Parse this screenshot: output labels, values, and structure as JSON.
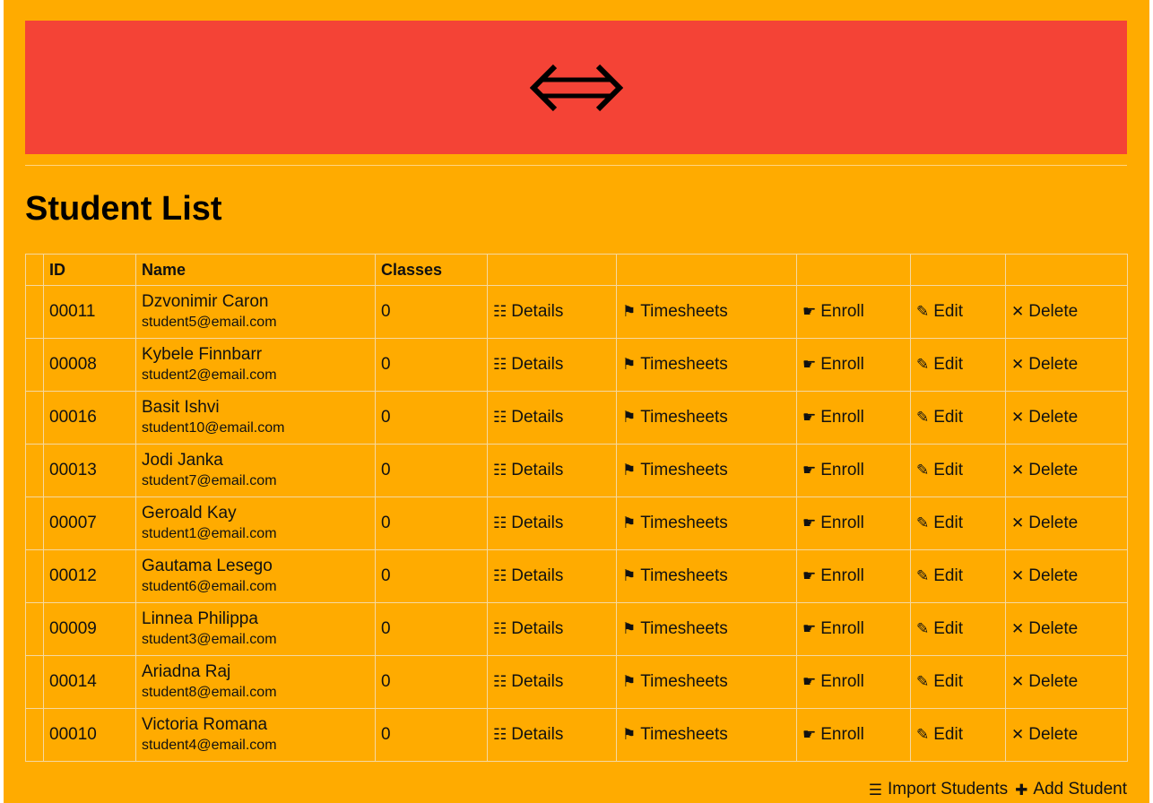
{
  "banner": {
    "icon": "left-right-arrow-icon",
    "color": "#f44336"
  },
  "theme": {
    "background": "#ffab00",
    "accent": "#f44336"
  },
  "page_title": "Student List",
  "table": {
    "headers": [
      "",
      "ID",
      "Name",
      "Classes",
      "",
      "",
      "",
      "",
      ""
    ],
    "actions": {
      "details": "Details",
      "timesheets": "Timesheets",
      "enroll": "Enroll",
      "edit": "Edit",
      "delete": "Delete"
    },
    "rows": [
      {
        "id": "00011",
        "name": "Dzvonimir Caron",
        "email": "student5@email.com",
        "classes": "0"
      },
      {
        "id": "00008",
        "name": "Kybele Finnbarr",
        "email": "student2@email.com",
        "classes": "0"
      },
      {
        "id": "00016",
        "name": "Basit Ishvi",
        "email": "student10@email.com",
        "classes": "0"
      },
      {
        "id": "00013",
        "name": "Jodi Janka",
        "email": "student7@email.com",
        "classes": "0"
      },
      {
        "id": "00007",
        "name": "Geroald Kay",
        "email": "student1@email.com",
        "classes": "0"
      },
      {
        "id": "00012",
        "name": "Gautama Lesego",
        "email": "student6@email.com",
        "classes": "0"
      },
      {
        "id": "00009",
        "name": "Linnea Philippa",
        "email": "student3@email.com",
        "classes": "0"
      },
      {
        "id": "00014",
        "name": "Ariadna Raj",
        "email": "student8@email.com",
        "classes": "0"
      },
      {
        "id": "00010",
        "name": "Victoria Romana",
        "email": "student4@email.com",
        "classes": "0"
      }
    ]
  },
  "footer": {
    "import_label": "Import Students",
    "add_label": "Add Student"
  }
}
